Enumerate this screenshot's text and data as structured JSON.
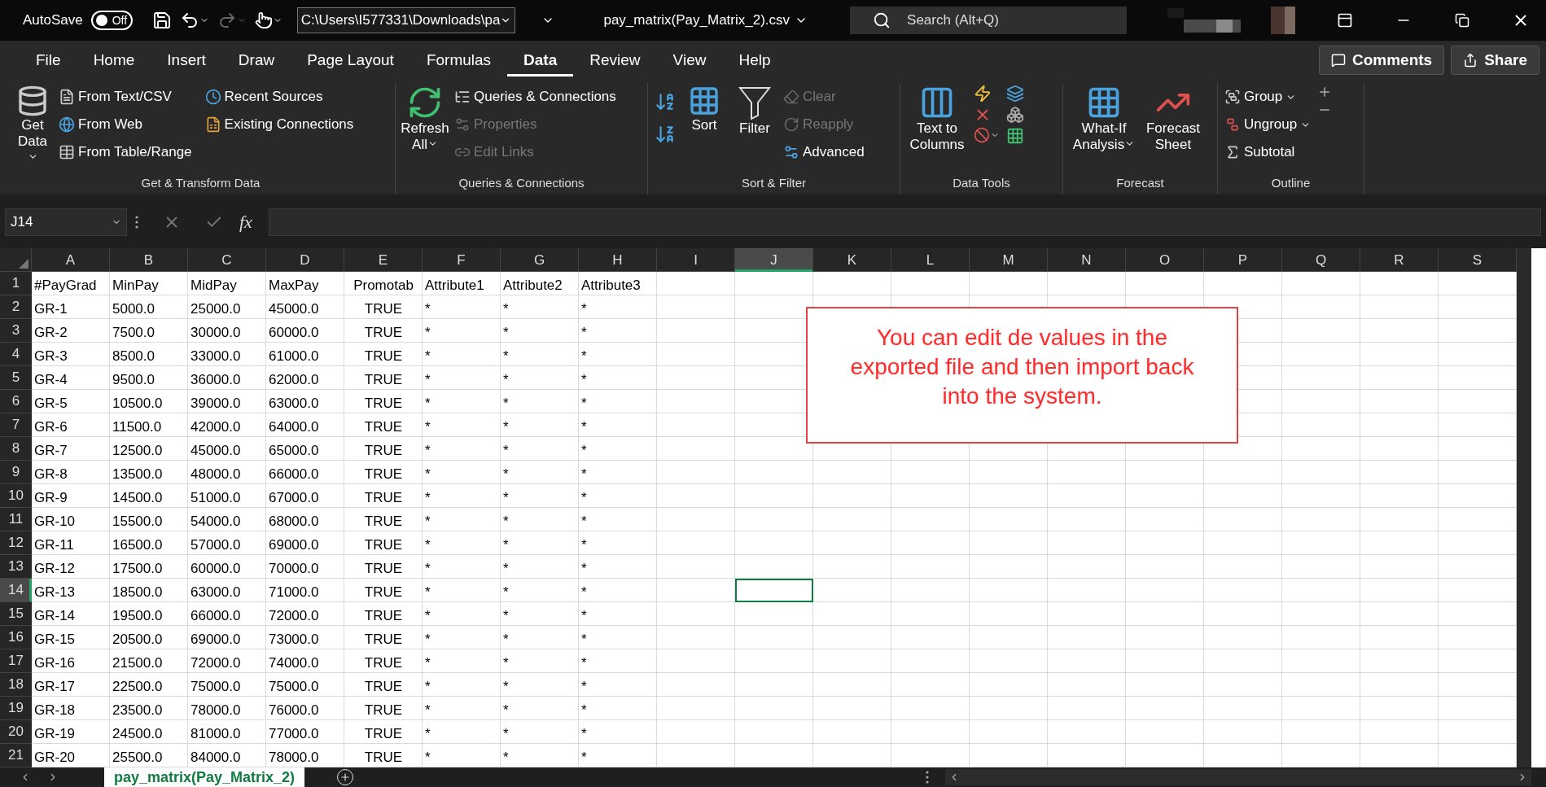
{
  "title_bar": {
    "autosave_label": "AutoSave",
    "autosave": {
      "on": false,
      "label": "Off"
    },
    "path": "C:\\Users\\I577331\\Downloads\\pa",
    "file_name": "pay_matrix(Pay_Matrix_2).csv",
    "search": {
      "placeholder": "Search (Alt+Q)"
    }
  },
  "menu_tabs": [
    {
      "label": "File",
      "selected": false
    },
    {
      "label": "Home",
      "selected": false
    },
    {
      "label": "Insert",
      "selected": false
    },
    {
      "label": "Draw",
      "selected": false
    },
    {
      "label": "Page Layout",
      "selected": false
    },
    {
      "label": "Formulas",
      "selected": false
    },
    {
      "label": "Data",
      "selected": true
    },
    {
      "label": "Review",
      "selected": false
    },
    {
      "label": "View",
      "selected": false
    },
    {
      "label": "Help",
      "selected": false
    }
  ],
  "actions": [
    "Comments",
    "Share"
  ],
  "ribbon_groups": [
    {
      "label": "Get & Transform Data",
      "items": [
        {
          "label": "Get Data",
          "menu": true,
          "disabled": false
        },
        {
          "label": "From Text/CSV",
          "menu": false,
          "disabled": false
        },
        {
          "label": "From Web",
          "menu": false,
          "disabled": false
        },
        {
          "label": "From Table/Range",
          "menu": false,
          "disabled": false
        },
        {
          "label": "Recent Sources",
          "menu": false,
          "disabled": false
        },
        {
          "label": "Existing Connections",
          "menu": false,
          "disabled": false
        }
      ]
    },
    {
      "label": "Queries & Connections",
      "items": [
        {
          "label": "Refresh All",
          "menu": true,
          "disabled": false
        },
        {
          "label": "Queries & Connections",
          "menu": false,
          "disabled": false
        },
        {
          "label": "Properties",
          "menu": false,
          "disabled": true
        },
        {
          "label": "Edit Links",
          "menu": false,
          "disabled": true
        }
      ]
    },
    {
      "label": "Sort & Filter",
      "items": [
        {
          "label": "Sort",
          "menu": false,
          "disabled": false
        },
        {
          "label": "Filter",
          "menu": false,
          "disabled": false
        },
        {
          "label": "Clear",
          "menu": false,
          "disabled": true
        },
        {
          "label": "Reapply",
          "menu": false,
          "disabled": true
        },
        {
          "label": "Advanced",
          "menu": false,
          "disabled": false
        }
      ]
    },
    {
      "label": "Data Tools",
      "items": [
        {
          "label": "Text to Columns",
          "menu": false,
          "disabled": false
        }
      ]
    },
    {
      "label": "Forecast",
      "items": [
        {
          "label": "What-If Analysis",
          "menu": true,
          "disabled": false
        },
        {
          "label": "Forecast Sheet",
          "menu": false,
          "disabled": false
        }
      ]
    },
    {
      "label": "Outline",
      "items": [
        {
          "label": "Group",
          "menu": true,
          "disabled": false
        },
        {
          "label": "Ungroup",
          "menu": true,
          "disabled": false
        },
        {
          "label": "Subtotal",
          "menu": false,
          "disabled": false
        }
      ]
    }
  ],
  "formula_bar": {
    "name_box": "J14",
    "function_label": "fx"
  },
  "columns": [
    {
      "label": "A",
      "selected": false
    },
    {
      "label": "B",
      "selected": false
    },
    {
      "label": "C",
      "selected": false
    },
    {
      "label": "D",
      "selected": false
    },
    {
      "label": "E",
      "selected": false
    },
    {
      "label": "F",
      "selected": false
    },
    {
      "label": "G",
      "selected": false
    },
    {
      "label": "H",
      "selected": false
    },
    {
      "label": "I",
      "selected": false
    },
    {
      "label": "J",
      "selected": true
    },
    {
      "label": "K",
      "selected": false
    },
    {
      "label": "L",
      "selected": false
    },
    {
      "label": "M",
      "selected": false
    },
    {
      "label": "N",
      "selected": false
    },
    {
      "label": "O",
      "selected": false
    },
    {
      "label": "P",
      "selected": false
    },
    {
      "label": "Q",
      "selected": false
    },
    {
      "label": "R",
      "selected": false
    },
    {
      "label": "S",
      "selected": false
    }
  ],
  "rows": [
    {
      "number": "1",
      "selected": false,
      "cells": [
        "#PayGrad",
        "MinPay",
        "MidPay",
        "MaxPay",
        "Promotab",
        "Attribute1",
        "Attribute2",
        "Attribute3"
      ]
    },
    {
      "number": "2",
      "selected": false,
      "cells": [
        "GR-1",
        "5000.0",
        "25000.0",
        "45000.0",
        "TRUE",
        "*",
        "*",
        "*"
      ]
    },
    {
      "number": "3",
      "selected": false,
      "cells": [
        "GR-2",
        "7500.0",
        "30000.0",
        "60000.0",
        "TRUE",
        "*",
        "*",
        "*"
      ]
    },
    {
      "number": "4",
      "selected": false,
      "cells": [
        "GR-3",
        "8500.0",
        "33000.0",
        "61000.0",
        "TRUE",
        "*",
        "*",
        "*"
      ]
    },
    {
      "number": "5",
      "selected": false,
      "cells": [
        "GR-4",
        "9500.0",
        "36000.0",
        "62000.0",
        "TRUE",
        "*",
        "*",
        "*"
      ]
    },
    {
      "number": "6",
      "selected": false,
      "cells": [
        "GR-5",
        "10500.0",
        "39000.0",
        "63000.0",
        "TRUE",
        "*",
        "*",
        "*"
      ]
    },
    {
      "number": "7",
      "selected": false,
      "cells": [
        "GR-6",
        "11500.0",
        "42000.0",
        "64000.0",
        "TRUE",
        "*",
        "*",
        "*"
      ]
    },
    {
      "number": "8",
      "selected": false,
      "cells": [
        "GR-7",
        "12500.0",
        "45000.0",
        "65000.0",
        "TRUE",
        "*",
        "*",
        "*"
      ]
    },
    {
      "number": "9",
      "selected": false,
      "cells": [
        "GR-8",
        "13500.0",
        "48000.0",
        "66000.0",
        "TRUE",
        "*",
        "*",
        "*"
      ]
    },
    {
      "number": "10",
      "selected": false,
      "cells": [
        "GR-9",
        "14500.0",
        "51000.0",
        "67000.0",
        "TRUE",
        "*",
        "*",
        "*"
      ]
    },
    {
      "number": "11",
      "selected": false,
      "cells": [
        "GR-10",
        "15500.0",
        "54000.0",
        "68000.0",
        "TRUE",
        "*",
        "*",
        "*"
      ]
    },
    {
      "number": "12",
      "selected": false,
      "cells": [
        "GR-11",
        "16500.0",
        "57000.0",
        "69000.0",
        "TRUE",
        "*",
        "*",
        "*"
      ]
    },
    {
      "number": "13",
      "selected": false,
      "cells": [
        "GR-12",
        "17500.0",
        "60000.0",
        "70000.0",
        "TRUE",
        "*",
        "*",
        "*"
      ]
    },
    {
      "number": "14",
      "selected": true,
      "cells": [
        "GR-13",
        "18500.0",
        "63000.0",
        "71000.0",
        "TRUE",
        "*",
        "*",
        "*"
      ]
    },
    {
      "number": "15",
      "selected": false,
      "cells": [
        "GR-14",
        "19500.0",
        "66000.0",
        "72000.0",
        "TRUE",
        "*",
        "*",
        "*"
      ]
    },
    {
      "number": "16",
      "selected": false,
      "cells": [
        "GR-15",
        "20500.0",
        "69000.0",
        "73000.0",
        "TRUE",
        "*",
        "*",
        "*"
      ]
    },
    {
      "number": "17",
      "selected": false,
      "cells": [
        "GR-16",
        "21500.0",
        "72000.0",
        "74000.0",
        "TRUE",
        "*",
        "*",
        "*"
      ]
    },
    {
      "number": "18",
      "selected": false,
      "cells": [
        "GR-17",
        "22500.0",
        "75000.0",
        "75000.0",
        "TRUE",
        "*",
        "*",
        "*"
      ]
    },
    {
      "number": "19",
      "selected": false,
      "cells": [
        "GR-18",
        "23500.0",
        "78000.0",
        "76000.0",
        "TRUE",
        "*",
        "*",
        "*"
      ]
    },
    {
      "number": "20",
      "selected": false,
      "cells": [
        "GR-19",
        "24500.0",
        "81000.0",
        "77000.0",
        "TRUE",
        "*",
        "*",
        "*"
      ]
    },
    {
      "number": "21",
      "selected": false,
      "cells": [
        "GR-20",
        "25500.0",
        "84000.0",
        "78000.0",
        "TRUE",
        "*",
        "*",
        "*"
      ]
    }
  ],
  "annotation": {
    "text": "You can edit de values in the exported file and then import back into the system."
  },
  "sheet_tabs": [
    {
      "label": "pay_matrix(Pay_Matrix_2)",
      "selected": true
    }
  ]
}
